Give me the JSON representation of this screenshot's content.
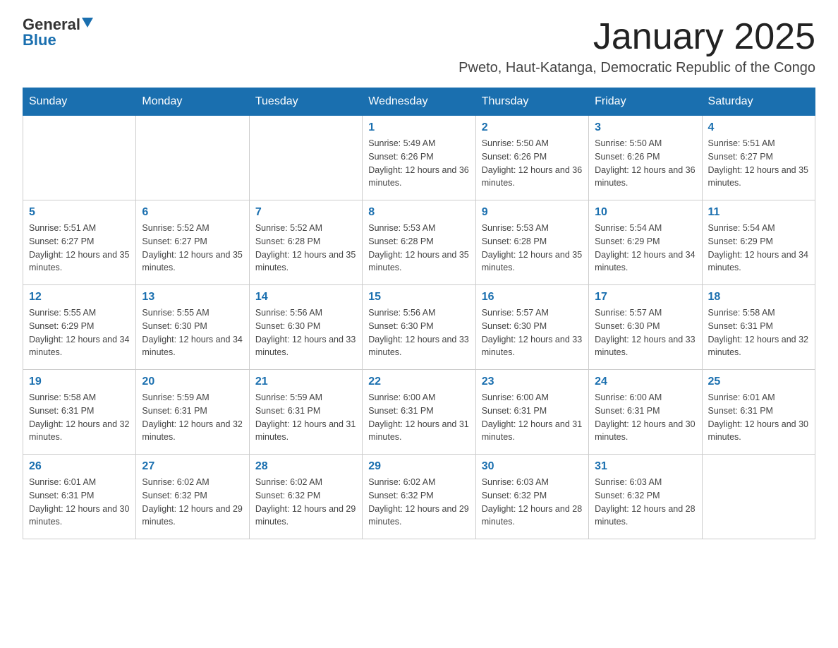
{
  "logo": {
    "text1": "General",
    "text2": "Blue"
  },
  "title": "January 2025",
  "subtitle": "Pweto, Haut-Katanga, Democratic Republic of the Congo",
  "weekdays": [
    "Sunday",
    "Monday",
    "Tuesday",
    "Wednesday",
    "Thursday",
    "Friday",
    "Saturday"
  ],
  "weeks": [
    [
      null,
      null,
      null,
      {
        "day": 1,
        "sunrise": "5:49 AM",
        "sunset": "6:26 PM",
        "daylight": "12 hours and 36 minutes."
      },
      {
        "day": 2,
        "sunrise": "5:50 AM",
        "sunset": "6:26 PM",
        "daylight": "12 hours and 36 minutes."
      },
      {
        "day": 3,
        "sunrise": "5:50 AM",
        "sunset": "6:26 PM",
        "daylight": "12 hours and 36 minutes."
      },
      {
        "day": 4,
        "sunrise": "5:51 AM",
        "sunset": "6:27 PM",
        "daylight": "12 hours and 35 minutes."
      }
    ],
    [
      {
        "day": 5,
        "sunrise": "5:51 AM",
        "sunset": "6:27 PM",
        "daylight": "12 hours and 35 minutes."
      },
      {
        "day": 6,
        "sunrise": "5:52 AM",
        "sunset": "6:27 PM",
        "daylight": "12 hours and 35 minutes."
      },
      {
        "day": 7,
        "sunrise": "5:52 AM",
        "sunset": "6:28 PM",
        "daylight": "12 hours and 35 minutes."
      },
      {
        "day": 8,
        "sunrise": "5:53 AM",
        "sunset": "6:28 PM",
        "daylight": "12 hours and 35 minutes."
      },
      {
        "day": 9,
        "sunrise": "5:53 AM",
        "sunset": "6:28 PM",
        "daylight": "12 hours and 35 minutes."
      },
      {
        "day": 10,
        "sunrise": "5:54 AM",
        "sunset": "6:29 PM",
        "daylight": "12 hours and 34 minutes."
      },
      {
        "day": 11,
        "sunrise": "5:54 AM",
        "sunset": "6:29 PM",
        "daylight": "12 hours and 34 minutes."
      }
    ],
    [
      {
        "day": 12,
        "sunrise": "5:55 AM",
        "sunset": "6:29 PM",
        "daylight": "12 hours and 34 minutes."
      },
      {
        "day": 13,
        "sunrise": "5:55 AM",
        "sunset": "6:30 PM",
        "daylight": "12 hours and 34 minutes."
      },
      {
        "day": 14,
        "sunrise": "5:56 AM",
        "sunset": "6:30 PM",
        "daylight": "12 hours and 33 minutes."
      },
      {
        "day": 15,
        "sunrise": "5:56 AM",
        "sunset": "6:30 PM",
        "daylight": "12 hours and 33 minutes."
      },
      {
        "day": 16,
        "sunrise": "5:57 AM",
        "sunset": "6:30 PM",
        "daylight": "12 hours and 33 minutes."
      },
      {
        "day": 17,
        "sunrise": "5:57 AM",
        "sunset": "6:30 PM",
        "daylight": "12 hours and 33 minutes."
      },
      {
        "day": 18,
        "sunrise": "5:58 AM",
        "sunset": "6:31 PM",
        "daylight": "12 hours and 32 minutes."
      }
    ],
    [
      {
        "day": 19,
        "sunrise": "5:58 AM",
        "sunset": "6:31 PM",
        "daylight": "12 hours and 32 minutes."
      },
      {
        "day": 20,
        "sunrise": "5:59 AM",
        "sunset": "6:31 PM",
        "daylight": "12 hours and 32 minutes."
      },
      {
        "day": 21,
        "sunrise": "5:59 AM",
        "sunset": "6:31 PM",
        "daylight": "12 hours and 31 minutes."
      },
      {
        "day": 22,
        "sunrise": "6:00 AM",
        "sunset": "6:31 PM",
        "daylight": "12 hours and 31 minutes."
      },
      {
        "day": 23,
        "sunrise": "6:00 AM",
        "sunset": "6:31 PM",
        "daylight": "12 hours and 31 minutes."
      },
      {
        "day": 24,
        "sunrise": "6:00 AM",
        "sunset": "6:31 PM",
        "daylight": "12 hours and 30 minutes."
      },
      {
        "day": 25,
        "sunrise": "6:01 AM",
        "sunset": "6:31 PM",
        "daylight": "12 hours and 30 minutes."
      }
    ],
    [
      {
        "day": 26,
        "sunrise": "6:01 AM",
        "sunset": "6:31 PM",
        "daylight": "12 hours and 30 minutes."
      },
      {
        "day": 27,
        "sunrise": "6:02 AM",
        "sunset": "6:32 PM",
        "daylight": "12 hours and 29 minutes."
      },
      {
        "day": 28,
        "sunrise": "6:02 AM",
        "sunset": "6:32 PM",
        "daylight": "12 hours and 29 minutes."
      },
      {
        "day": 29,
        "sunrise": "6:02 AM",
        "sunset": "6:32 PM",
        "daylight": "12 hours and 29 minutes."
      },
      {
        "day": 30,
        "sunrise": "6:03 AM",
        "sunset": "6:32 PM",
        "daylight": "12 hours and 28 minutes."
      },
      {
        "day": 31,
        "sunrise": "6:03 AM",
        "sunset": "6:32 PM",
        "daylight": "12 hours and 28 minutes."
      },
      null
    ]
  ]
}
